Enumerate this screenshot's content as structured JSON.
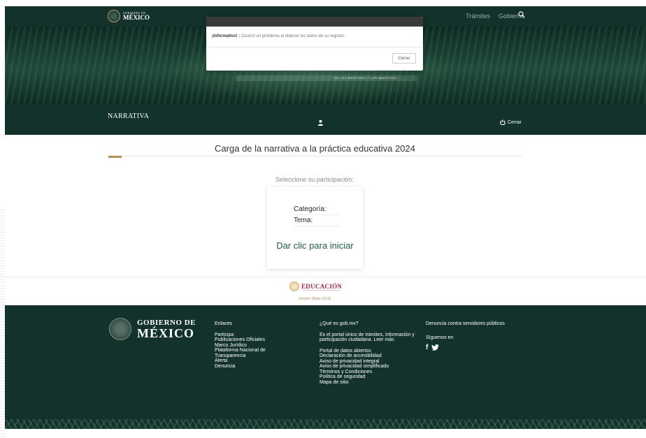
{
  "header": {
    "brand_small": "GOBIERNO DE",
    "brand_big": "MÉXICO",
    "nav": [
      "Trámites",
      "Gobierno"
    ],
    "icons": {
      "search": "search-icon"
    }
  },
  "banner": {
    "caption": "DE LAS MAESTRAS Y LOS MAESTROS"
  },
  "section": {
    "title": "NARRATIVA",
    "logout_label": "Cerrar"
  },
  "main": {
    "title": "Carga de la narrativa a la práctica educativa 2024",
    "select_label": "Seleccione su participación:",
    "card": {
      "category_label": "Categoría:",
      "topic_label": "Tema:",
      "cta": "Dar clic para iniciar"
    }
  },
  "edu": {
    "name": "EDUCACIÓN",
    "version": "Versión: [Beta v13.5]"
  },
  "footer": {
    "brand_l1": "GOBIERNO DE",
    "brand_l2": "MÉXICO",
    "links": {
      "heading": "Enlaces",
      "items": [
        "Participa",
        "Publicaciones Oficiales",
        "Marco Jurídico",
        "Plataforma Nacional de Transparencia",
        "Alerta",
        "Denuncia"
      ]
    },
    "about": {
      "heading": "¿Qué es gob.mx?",
      "description": "Es el portal único de trámites, información y participación ciudadana. Leer más",
      "items": [
        "Portal de datos abiertos",
        "Declaración de accesibilidad",
        "Aviso de privacidad integral",
        "Aviso de privacidad simplificado",
        "Términos y Condiciones",
        "Política de seguridad",
        "Mapa de sitio"
      ]
    },
    "contact": {
      "denuncia": "Denuncia contra servidores públicos",
      "follow": "Síguenos en",
      "social": [
        "facebook-icon",
        "twitter-icon"
      ]
    }
  },
  "modal": {
    "label": "¡Informativo! :",
    "message": "Ocurrió un problema al obtener los datos de su registro.",
    "button": "Cerrar"
  },
  "colors": {
    "primary_dark": "#13322b",
    "accent_gold": "#b38e5d",
    "edu_maroon": "#9d2449",
    "cta_green": "#235b4e"
  }
}
